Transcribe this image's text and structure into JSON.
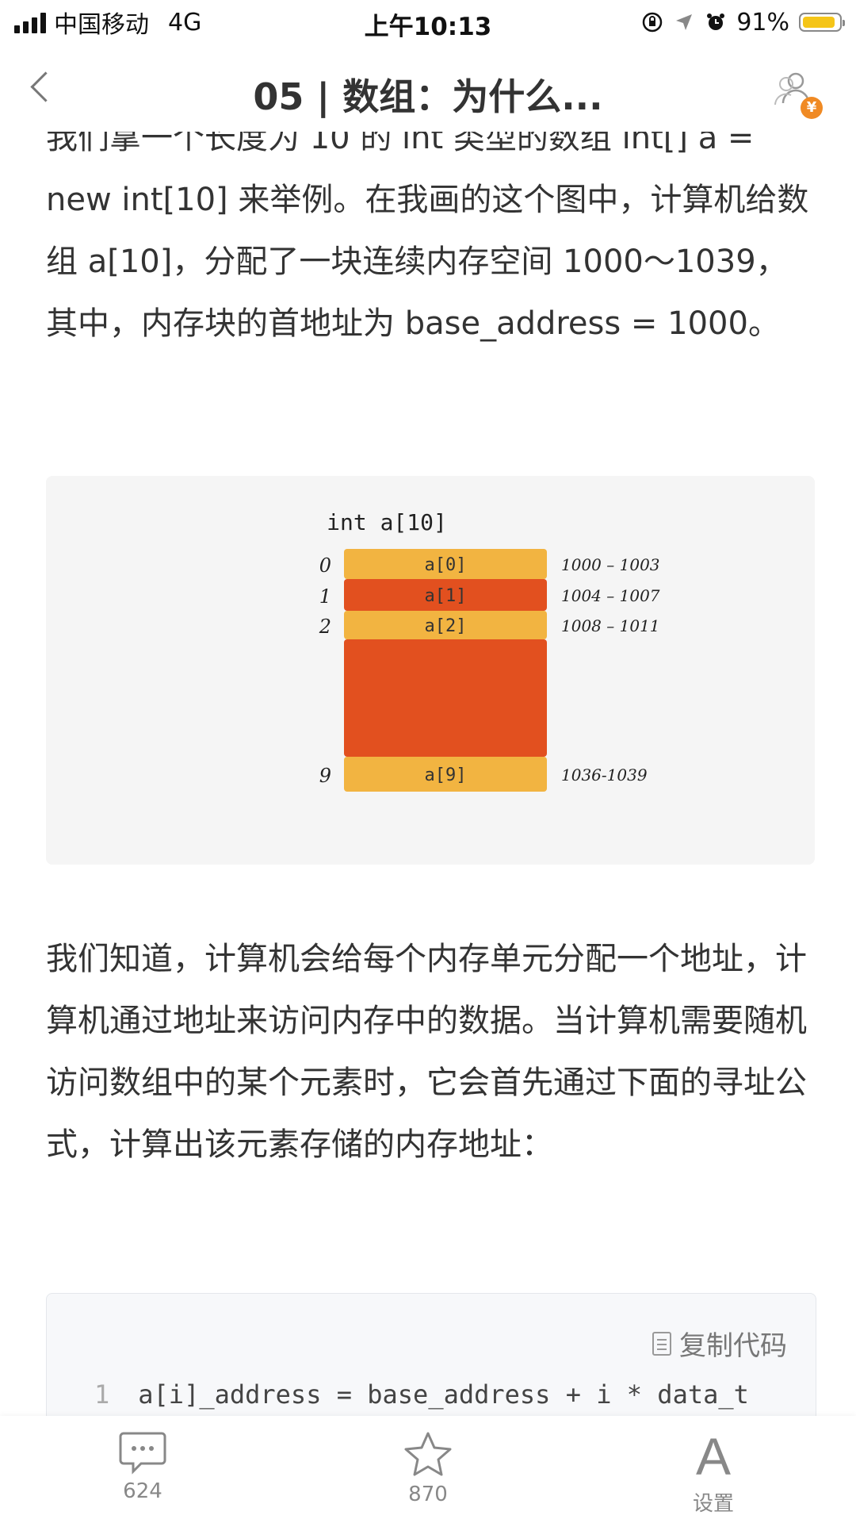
{
  "status_bar": {
    "carrier": "中国移动",
    "network": "4G",
    "time": "上午10:13",
    "battery": "91%",
    "battery_level": 0.91,
    "battery_color": "#f5c518"
  },
  "nav": {
    "back_icon": "chevron-left-icon",
    "title": "05 | 数组：为什么...",
    "reward_icon": "reward-user-icon",
    "reward_badge": "¥"
  },
  "article": {
    "para1": "我们拿一个长度为 10 的 int 类型的数组 int[] a = new int[10] 来举例。在我画的这个图中，计算机给数组 a[10]，分配了一块连续内存空间 1000～1039，其中，内存块的首地址为 base_address = 1000。",
    "figure": {
      "title": "int a[10]",
      "rows": [
        {
          "index": "0",
          "label": "a[0]",
          "range": "1000 – 1003",
          "color": "#f2b441"
        },
        {
          "index": "1",
          "label": "a[1]",
          "range": "1004 – 1007",
          "color": "#e2501f"
        },
        {
          "index": "2",
          "label": "a[2]",
          "range": "1008 – 1011",
          "color": "#f2b441"
        },
        {
          "index": "",
          "label": "",
          "range": "",
          "color": "#e2501f"
        },
        {
          "index": "9",
          "label": "a[9]",
          "range": "1036-1039",
          "color": "#f2b441"
        }
      ]
    },
    "para2": "我们知道，计算机会给每个内存单元分配一个地址，计算机通过地址来访问内存中的数据。当计算机需要随机访问数组中的某个元素时，它会首先通过下面的寻址公式，计算出该元素存储的内存地址：",
    "code": {
      "copy_label": "复制代码",
      "line_number": "1",
      "line": "a[i]_address = base_address + i * data_t"
    }
  },
  "bottom_bar": {
    "comments_count": "624",
    "stars_count": "870",
    "settings_label": "设置",
    "settings_glyph": "A"
  }
}
